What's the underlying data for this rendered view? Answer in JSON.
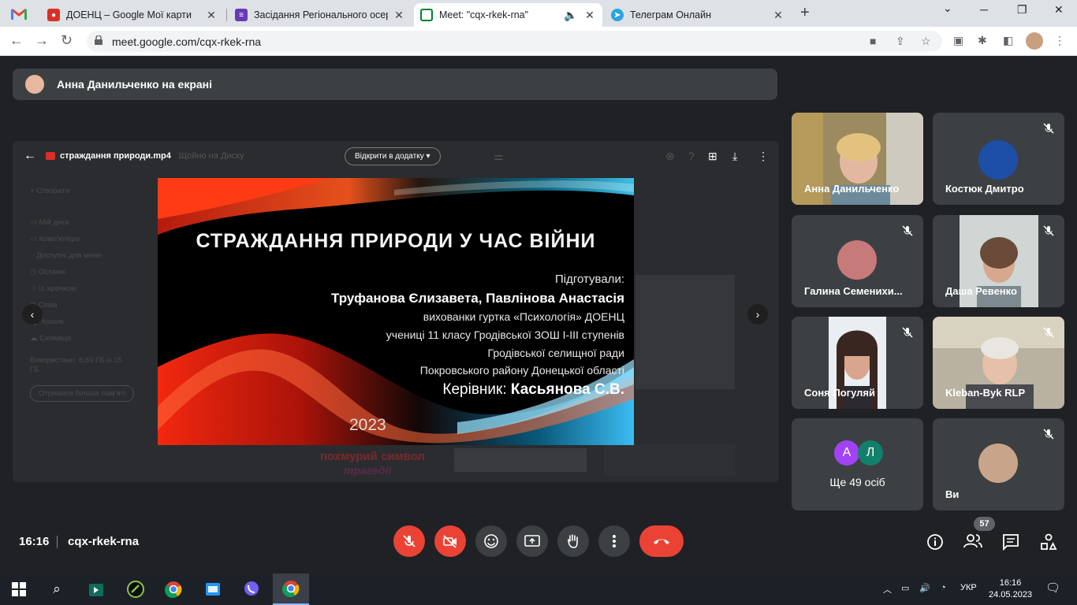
{
  "browser": {
    "tabs": [
      {
        "title": "ДОЕНЦ – Google Мої карти"
      },
      {
        "title": "Засідання Регіонального осеред"
      },
      {
        "title": "Meet: \"cqx-rkek-rna\""
      },
      {
        "title": "Телеграм Онлайн"
      }
    ],
    "url": "meet.google.com/cqx-rkek-rna"
  },
  "meet": {
    "presenting_banner": "Анна Данильченко на екрані",
    "shared": {
      "file_name": "страждання природи.mp4",
      "share_hint": "Щойно на Диску",
      "open_with": "Відкрити в додатку",
      "drive_items": [
        "Створити",
        "Мій диск",
        "Комп'ютери",
        "Доступні для мене",
        "Останні",
        "Із зірочкою",
        "Спам",
        "Кошик",
        "Сховище"
      ],
      "storage_text": "Використано: 6,69 ГБ із 15 ГБ",
      "storage_button": "Отримати більше пам'яті",
      "bg_caption1": "похмурий символ",
      "bg_caption2": "трагедії"
    },
    "slide": {
      "title": "СТРАЖДАННЯ ПРИРОДИ У ЧАС ВІЙНИ",
      "prepared_label": "Підготували:",
      "authors": "Труфанова Єлизавета, Павлінова Анастасія",
      "line3": "вихованки гуртка «Психологія» ДОЕНЦ",
      "line4": "учениці 11 класу Гродівської ЗОШ І-ІІІ ступенів",
      "line5": "Гродівської селищної ради",
      "line6": "Покровського району Донецької області",
      "supervisor_label": "Керівник:",
      "supervisor": "Касьянова С.В.",
      "year": "2023"
    },
    "participants": [
      {
        "name": "Анна Данильченко"
      },
      {
        "name": "Костюк Дмитро"
      },
      {
        "name": "Галина Семенихи..."
      },
      {
        "name": "Даша Ревенко"
      },
      {
        "name": "Соня Погуляй"
      },
      {
        "name": "Kleban-Byk RLP"
      },
      {
        "name": "Ще 49 осіб",
        "initials": [
          "А",
          "Л"
        ]
      },
      {
        "name": "Ви"
      }
    ],
    "time": "16:16",
    "meeting_code": "cqx-rkek-rna",
    "people_count": "57"
  },
  "taskbar": {
    "lang": "УКР",
    "time": "16:16",
    "date": "24.05.2023"
  }
}
